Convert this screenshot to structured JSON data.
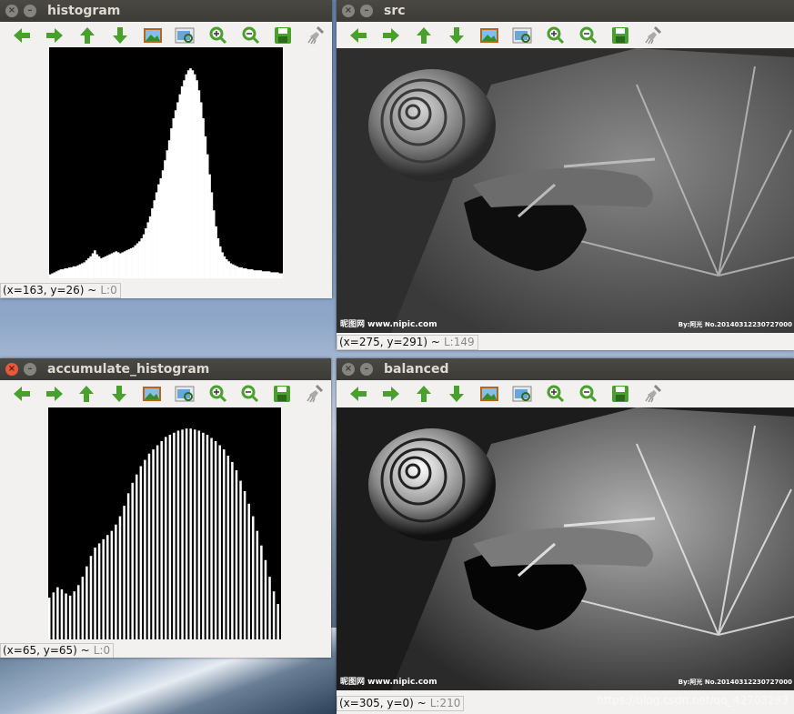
{
  "toolbar_icons": [
    "arrow-left-icon",
    "arrow-right-icon",
    "arrow-up-icon",
    "arrow-down-icon",
    "save-image-icon",
    "properties-icon",
    "zoom-in-icon",
    "zoom-out-icon",
    "save-icon",
    "clear-icon"
  ],
  "colors": {
    "accent_green": "#4aa02c",
    "close_red": "#e8593a",
    "titlebar": "#3c3b37"
  },
  "windows": {
    "histogram": {
      "title": "histogram",
      "status_coords": "(x=163, y=26) ~",
      "status_level": "L:0"
    },
    "src": {
      "title": "src",
      "status_coords": "(x=275, y=291) ~",
      "status_level": "L:149",
      "watermark_left": "昵图网 www.nipic.com",
      "watermark_right": "By:阿光 No.20140312230727000"
    },
    "accumulate": {
      "title": "accumulate_histogram",
      "status_coords": "(x=65, y=65) ~",
      "status_level": "L:0"
    },
    "balanced": {
      "title": "balanced",
      "status_coords": "(x=305, y=0) ~",
      "status_level": "L:210",
      "watermark_left": "昵图网 www.nipic.com",
      "watermark_right": "By:阿光 No.20140312230727000"
    }
  },
  "footer_watermark": "https://blog.csdn.net/qq_42703283",
  "chart_data": [
    {
      "type": "bar",
      "title": "histogram",
      "values": [
        4,
        5,
        6,
        7,
        8,
        9,
        9,
        10,
        10,
        11,
        11,
        12,
        12,
        13,
        14,
        15,
        16,
        18,
        20,
        22,
        25,
        28,
        24,
        22,
        20,
        21,
        22,
        23,
        24,
        25,
        26,
        27,
        26,
        25,
        26,
        27,
        28,
        29,
        30,
        31,
        33,
        35,
        37,
        40,
        44,
        50,
        56,
        62,
        70,
        78,
        86,
        94,
        100,
        108,
        118,
        128,
        138,
        150,
        160,
        168,
        176,
        184,
        192,
        198,
        204,
        208,
        210,
        208,
        204,
        198,
        188,
        176,
        160,
        142,
        124,
        104,
        86,
        68,
        52,
        40,
        32,
        26,
        22,
        19,
        17,
        15,
        14,
        13,
        12,
        11,
        11,
        10,
        10,
        9,
        9,
        9,
        8,
        8,
        8,
        8,
        7,
        7,
        7,
        7,
        6,
        6,
        6,
        6,
        5,
        5
      ]
    },
    {
      "type": "bar",
      "title": "accumulate_histogram",
      "values": [
        40,
        45,
        50,
        48,
        44,
        42,
        46,
        52,
        60,
        70,
        80,
        88,
        92,
        96,
        100,
        104,
        110,
        118,
        128,
        140,
        150,
        158,
        166,
        172,
        178,
        182,
        186,
        190,
        194,
        196,
        198,
        200,
        201,
        202,
        202,
        201,
        200,
        198,
        196,
        193,
        190,
        186,
        182,
        176,
        170,
        162,
        152,
        142,
        130,
        118,
        104,
        90,
        76,
        60,
        46,
        34
      ]
    }
  ]
}
